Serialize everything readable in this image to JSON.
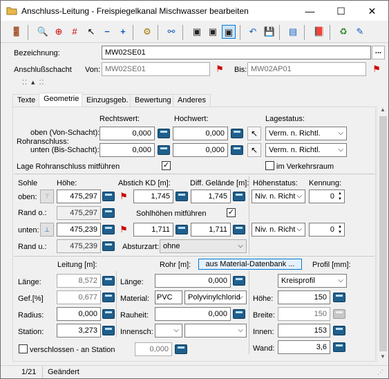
{
  "window": {
    "title": "Anschluss-Leitung - Freispiegelkanal Mischwasser bearbeiten",
    "minimize": "—",
    "maximize": "☐",
    "close": "✕"
  },
  "header": {
    "bezeichnung_label": "Bezeichnung:",
    "bezeichnung_value": "MW02SE01",
    "more_btn": "...",
    "anschlussschacht_label": "Anschlußschacht",
    "von_label": "Von:",
    "von_value": "MW02SE01",
    "bis_label": "Bis:",
    "bis_value": "MW02AP01",
    "splitter": "⁚⁚ ▲ ⁚⁚"
  },
  "tabs": [
    "Texte",
    "Geometrie",
    "Einzugsgeb.",
    "Bewertung",
    "Anderes"
  ],
  "active_tab": "Geometrie",
  "geometrie": {
    "rechtswert_label": "Rechtswert:",
    "hochwert_label": "Hochwert:",
    "lagestatus_label": "Lagestatus:",
    "oben_von_label": "oben (Von-Schacht):",
    "rohranschluss_label": "Rohranschluss:",
    "unten_bis_label": "unten (Bis-Schacht):",
    "oben_rechtswert": "0,000",
    "oben_hochwert": "0,000",
    "unten_rechtswert": "0,000",
    "unten_hochwert": "0,000",
    "lagestatus_oben": "Verm. n. Richtl.",
    "lagestatus_unten": "Verm. n. Richtl.",
    "lage_mitfuehren_label": "Lage Rohranschluss mitführen",
    "lage_mitfuehren_checked": "✓",
    "im_verkehrsraum_label": "im Verkehrsraum",
    "sohle_label": "Sohle",
    "hoehe_label": "Höhe:",
    "abstich_label": "Abstich KD [m]:",
    "diff_gelaende_label": "Diff. Gelände [m]:",
    "hoehenstatus_label": "Höhenstatus:",
    "kennung_label": "Kennung:",
    "oben_label": "oben:",
    "oben_hoehe": "475,297",
    "oben_abstich": "1,745",
    "oben_diff": "1,745",
    "oben_hoehenstatus": "Niv. n. Richt",
    "oben_kennung": "0",
    "rand_o_label": "Rand o.:",
    "rand_o_value": "475,297",
    "sohlhoehen_label": "Sohlhöhen mitführen",
    "sohlhoehen_checked": "✓",
    "unten_label": "unten:",
    "unten_hoehe": "475,239",
    "unten_abstich": "1,711",
    "unten_diff": "1,711",
    "unten_hoehenstatus": "Niv. n. Richt",
    "unten_kennung": "0",
    "rand_u_label": "Rand u.:",
    "rand_u_value": "475,239",
    "absturzart_label": "Absturzart:",
    "absturzart_value": "ohne",
    "leitung_label": "Leitung [m]:",
    "rohr_label": "Rohr [m]:",
    "material_db_btn": "aus Material-Datenbank ...",
    "profil_label": "Profil [mm]:",
    "laenge_label": "Länge:",
    "leitung_laenge": "8,572",
    "rohr_laenge_label": "Länge:",
    "rohr_laenge": "0,000",
    "profil_value": "Kreisprofil",
    "gef_label": "Gef.[%]",
    "gef_value": "0,677",
    "material_label": "Material:",
    "material_code": "PVC",
    "material_name": "Polyvinylchlorid",
    "hoehe_profil_label": "Höhe:",
    "hoehe_profil": "150",
    "radius_label": "Radius:",
    "radius_value": "0,000",
    "rauheit_label": "Rauheit:",
    "rauheit_value": "0,000",
    "breite_label": "Breite:",
    "breite_value": "150",
    "station_label": "Station:",
    "station_value": "3,273",
    "innensch_label": "Innensch:",
    "innen_label": "Innen:",
    "innen_value": "153",
    "wand_label": "Wand:",
    "wand_value": "3,6",
    "verschlossen_label": "verschlossen   -   an Station",
    "verschlossen_station": "0,000"
  },
  "status": {
    "record": "1/21",
    "state": "Geändert"
  },
  "colors": {
    "calc_blue": "#1f5f8c",
    "accent": "#0078d7"
  }
}
